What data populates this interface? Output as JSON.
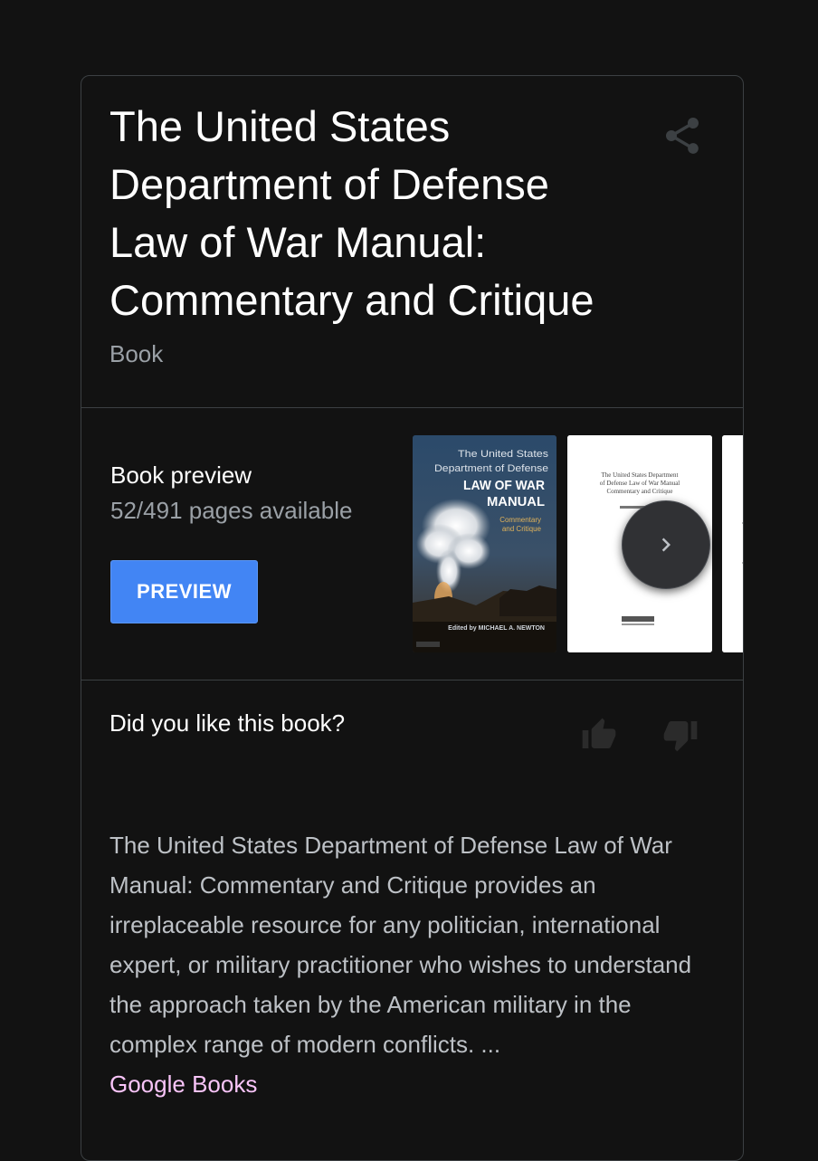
{
  "header": {
    "title": "The United States Department of Defense Law of War Manual: Commentary and Critique",
    "type_label": "Book",
    "share_icon": "share-icon"
  },
  "preview": {
    "heading": "Book preview",
    "pages_available": "52/491 pages available",
    "button_label": "PREVIEW",
    "cover": {
      "title_line1": "The United States",
      "title_line2": "Department of Defense",
      "title_line3": "LAW OF WAR",
      "title_line4": "MANUAL",
      "subtitle_line1": "Commentary",
      "subtitle_line2": "and Critique",
      "editor": "Edited by MICHAEL A. NEWTON"
    },
    "page2_text": {
      "line1": "The United States Department",
      "line2": "of Defense Law of War Manual",
      "line3": "Commentary and Critique"
    },
    "next_icon": "chevron-right-icon"
  },
  "rating": {
    "question": "Did you like this book?",
    "like_icon": "thumb-up-icon",
    "dislike_icon": "thumb-down-icon"
  },
  "description": {
    "text": "The United States Department of Defense Law of War Manual: Commentary and Critique provides an irreplaceable resource for any politician, international expert, or military practitioner who wishes to understand the approach taken by the American military in the complex range of modern conflicts. ...",
    "source": "Google Books"
  },
  "colors": {
    "background": "#121212",
    "border": "#3c4043",
    "button": "#4285f4",
    "link": "#f8c4f8",
    "muted_text": "#9aa0a6"
  }
}
